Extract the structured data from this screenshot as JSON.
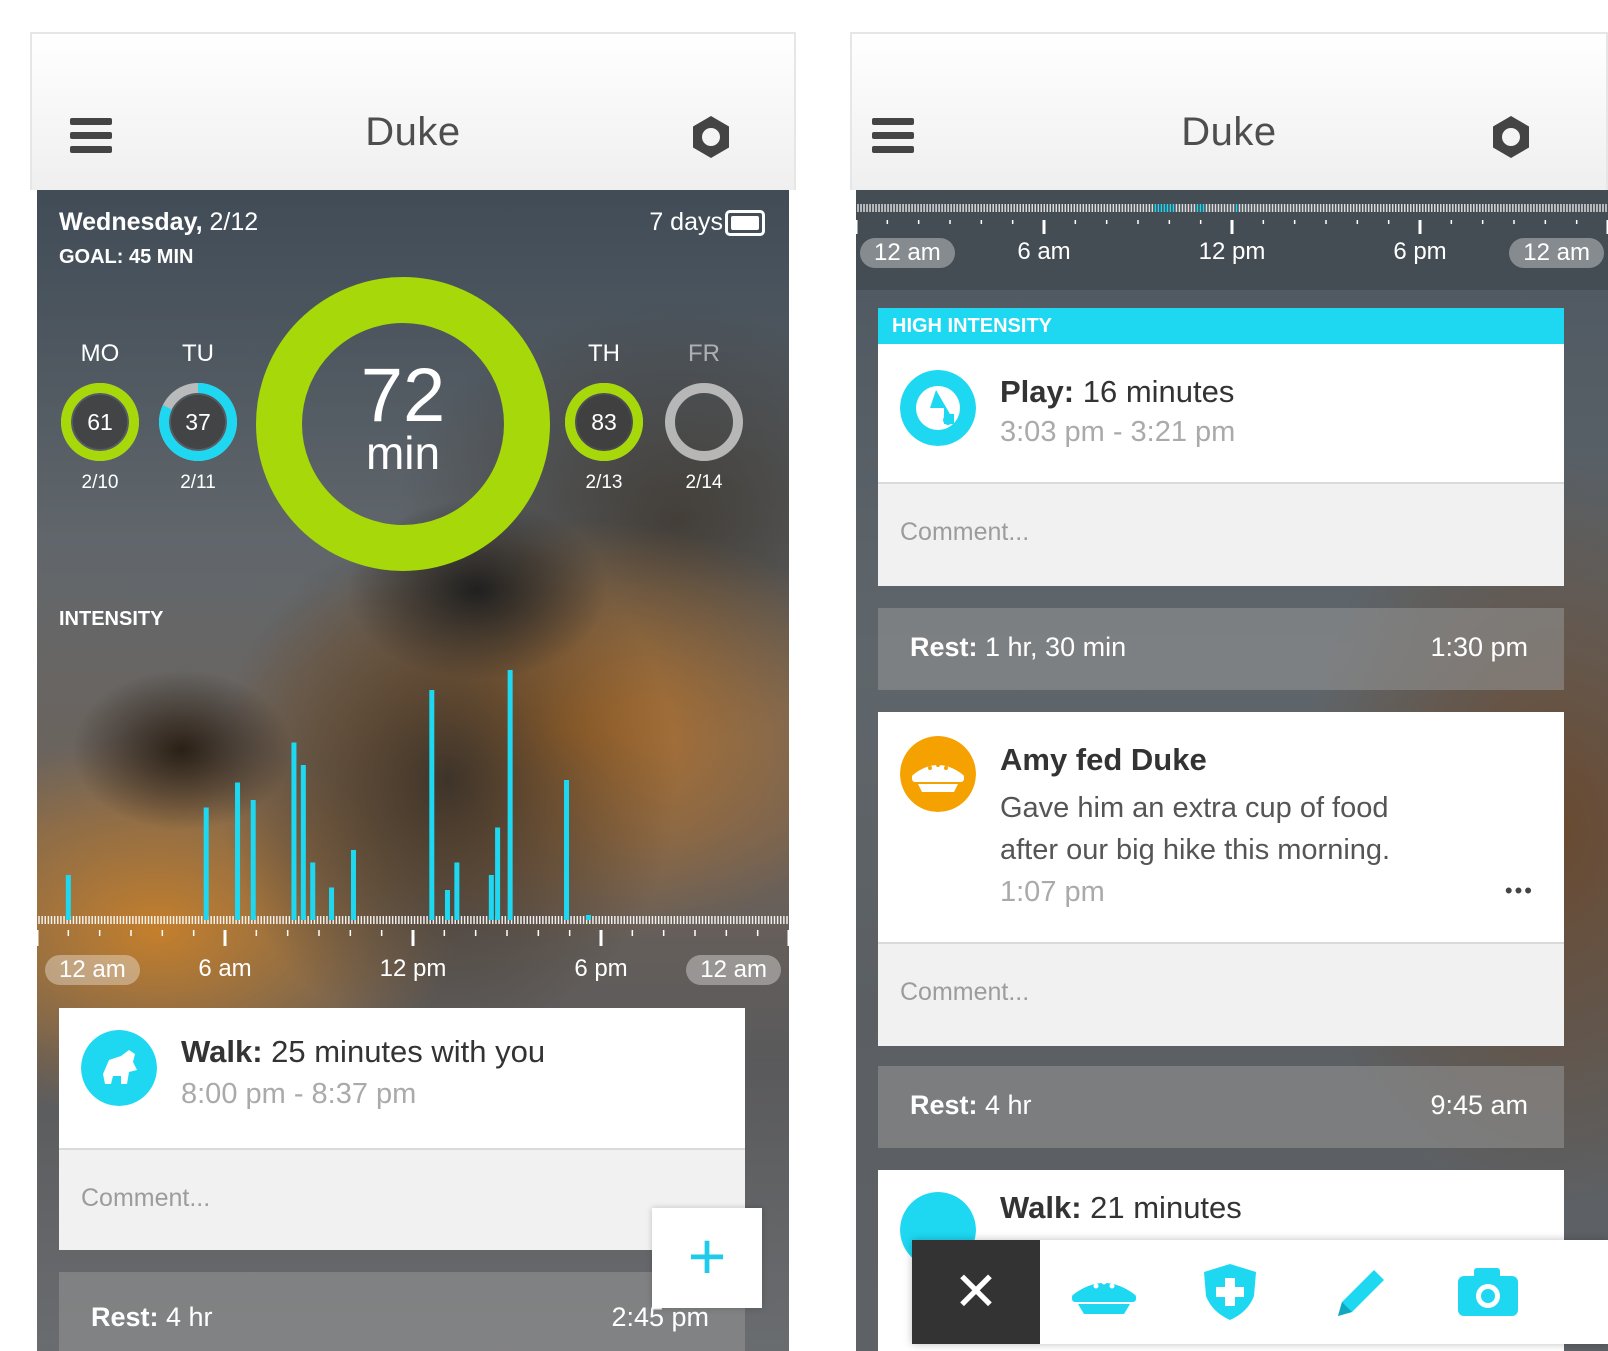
{
  "left": {
    "nav": {
      "title": "Duke"
    },
    "hero": {
      "day_label": "Wednesday,",
      "date": "2/12",
      "goal": "GOAL: 45 MIN",
      "range_label": "7 days",
      "today_value": "72",
      "today_unit": "min",
      "days": [
        {
          "label": "MO",
          "value": "61",
          "date": "2/10",
          "progress": 1.0,
          "color": "#a6d80a"
        },
        {
          "label": "TU",
          "value": "37",
          "date": "2/11",
          "progress": 0.82,
          "color": "#1ed8f2"
        },
        {
          "label": "TH",
          "value": "83",
          "date": "2/13",
          "progress": 1.0,
          "color": "#a6d80a"
        },
        {
          "label": "FR",
          "value": "",
          "date": "2/14",
          "progress": 0,
          "color": "#cccccc"
        }
      ],
      "intensity_label": "INTENSITY",
      "time_labels": [
        "12 am",
        "6 am",
        "12 pm",
        "6 pm",
        "12 am"
      ]
    },
    "walk_card": {
      "title_bold": "Walk:",
      "title_rest": " 25 minutes with you",
      "time": "8:00 pm - 8:37 pm",
      "comment_placeholder": "Comment..."
    },
    "rest_row": {
      "label_bold": "Rest:",
      "label_rest": " 4 hr",
      "time": "2:45 pm"
    },
    "fab_label": "+"
  },
  "right": {
    "nav": {
      "title": "Duke"
    },
    "time_labels": [
      "12 am",
      "6 am",
      "12 pm",
      "6 pm",
      "12 am"
    ],
    "high_intensity_label": "HIGH INTENSITY",
    "play_card": {
      "title_bold": "Play:",
      "title_rest": " 16 minutes",
      "time": "3:03 pm - 3:21 pm",
      "comment_placeholder": "Comment..."
    },
    "rest1": {
      "label_bold": "Rest:",
      "label_rest": " 1 hr, 30 min",
      "time": "1:30 pm"
    },
    "feed_card": {
      "title": "Amy fed Duke",
      "line1": "Gave him an extra cup of food",
      "line2": "after our big hike this morning.",
      "time": "1:07 pm",
      "more": "•••",
      "comment_placeholder": "Comment..."
    },
    "rest2": {
      "label_bold": "Rest:",
      "label_rest": " 4 hr",
      "time": "9:45 am"
    },
    "walk_partial": {
      "title_bold": "Walk:",
      "title_rest": " 21 minutes"
    },
    "toolbar": {
      "close": "✕",
      "icons": [
        "food-bowl-icon",
        "health-shield-icon",
        "pencil-icon",
        "camera-icon"
      ]
    }
  },
  "colors": {
    "accent_green": "#a6d80a",
    "accent_cyan": "#1ed8f2",
    "accent_orange": "#f5a200"
  },
  "chart_data": {
    "type": "bar",
    "title": "INTENSITY",
    "x_unit": "hour of day",
    "x": [
      1.0,
      5.4,
      6.4,
      6.9,
      8.2,
      8.5,
      8.8,
      9.4,
      10.1,
      12.6,
      13.1,
      13.4,
      14.5,
      14.7,
      15.1,
      16.9,
      17.6
    ],
    "values": [
      0.18,
      0.45,
      0.55,
      0.48,
      0.71,
      0.62,
      0.23,
      0.13,
      0.28,
      0.92,
      0.12,
      0.23,
      0.18,
      0.37,
      1.0,
      0.56,
      0.02
    ],
    "xlim": [
      0,
      24
    ],
    "ylim": [
      0,
      1
    ],
    "tick_labels": [
      "12 am",
      "6 am",
      "12 pm",
      "6 pm",
      "12 am"
    ],
    "color": "#1ed8f2"
  }
}
